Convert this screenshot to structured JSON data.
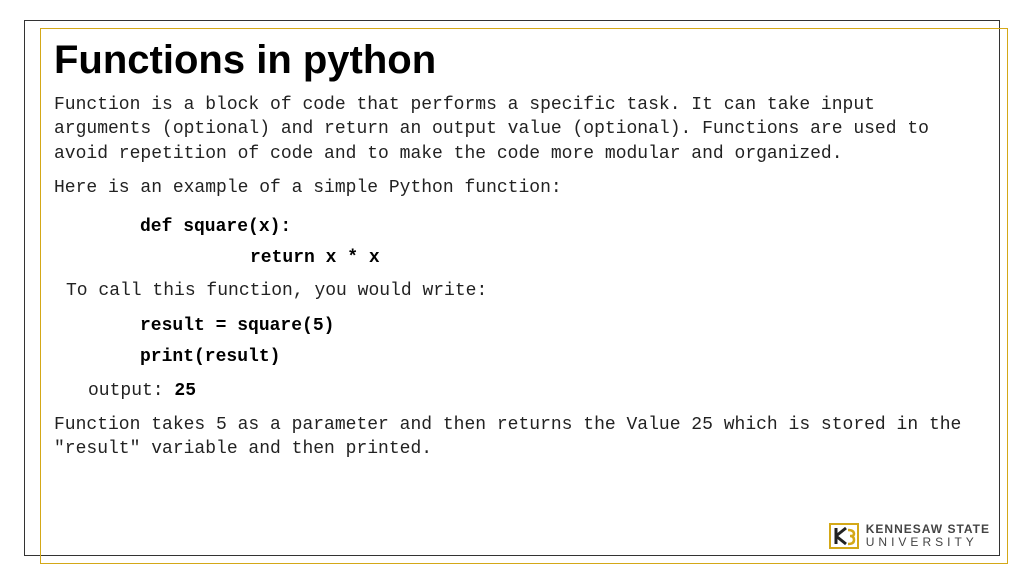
{
  "title": "Functions in python",
  "para1": "Function is a block of code that performs a specific task. It can take input arguments (optional) and return an output value (optional). Functions are used to avoid repetition of code and to make the code more modular and organized.",
  "intro": "Here is an example of a simple Python function:",
  "code": {
    "def_line": "def square(x):",
    "return_line": "return x * x"
  },
  "call_intro": "To call this function, you would write:",
  "call": {
    "line1": "result = square(5)",
    "line2": "print(result)"
  },
  "output_label": "output: ",
  "output_value": "25",
  "para2": "Function takes 5 as a parameter and then returns the Value 25 which is stored in the \"result\" variable and then printed.",
  "logo": {
    "top": "KENNESAW STATE",
    "bottom": "UNIVERSITY"
  }
}
